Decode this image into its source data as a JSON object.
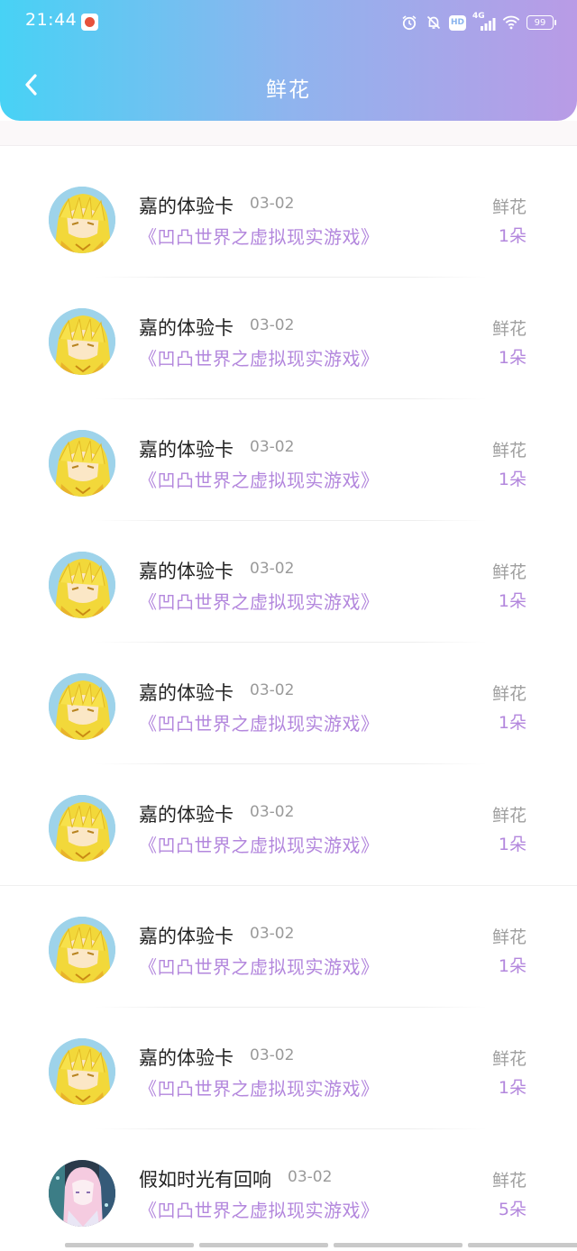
{
  "status_bar": {
    "time": "21:44",
    "network": "4G",
    "battery": "99",
    "hd": "HD"
  },
  "header": {
    "title": "鲜花"
  },
  "records": [
    {
      "user": "嘉的体验卡",
      "date": "03-02",
      "book": "《凹凸世界之虚拟现实游戏》",
      "gift": "鲜花",
      "count": "1朵",
      "avatar": "blonde-character-avatar"
    },
    {
      "user": "嘉的体验卡",
      "date": "03-02",
      "book": "《凹凸世界之虚拟现实游戏》",
      "gift": "鲜花",
      "count": "1朵",
      "avatar": "blonde-character-avatar"
    },
    {
      "user": "嘉的体验卡",
      "date": "03-02",
      "book": "《凹凸世界之虚拟现实游戏》",
      "gift": "鲜花",
      "count": "1朵",
      "avatar": "blonde-character-avatar"
    },
    {
      "user": "嘉的体验卡",
      "date": "03-02",
      "book": "《凹凸世界之虚拟现实游戏》",
      "gift": "鲜花",
      "count": "1朵",
      "avatar": "blonde-character-avatar"
    },
    {
      "user": "嘉的体验卡",
      "date": "03-02",
      "book": "《凹凸世界之虚拟现实游戏》",
      "gift": "鲜花",
      "count": "1朵",
      "avatar": "blonde-character-avatar"
    },
    {
      "user": "嘉的体验卡",
      "date": "03-02",
      "book": "《凹凸世界之虚拟现实游戏》",
      "gift": "鲜花",
      "count": "1朵",
      "avatar": "blonde-character-avatar"
    },
    {
      "user": "嘉的体验卡",
      "date": "03-02",
      "book": "《凹凸世界之虚拟现实游戏》",
      "gift": "鲜花",
      "count": "1朵",
      "avatar": "blonde-character-avatar"
    },
    {
      "user": "嘉的体验卡",
      "date": "03-02",
      "book": "《凹凸世界之虚拟现实游戏》",
      "gift": "鲜花",
      "count": "1朵",
      "avatar": "blonde-character-avatar"
    },
    {
      "user": "假如时光有回响",
      "date": "03-02",
      "book": "《凹凸世界之虚拟现实游戏》",
      "gift": "鲜花",
      "count": "5朵",
      "avatar": "pink-hair-character-avatar"
    }
  ],
  "colors": {
    "accent": "#b387dd",
    "header_start": "#47d2f5",
    "header_end": "#b99be6"
  }
}
